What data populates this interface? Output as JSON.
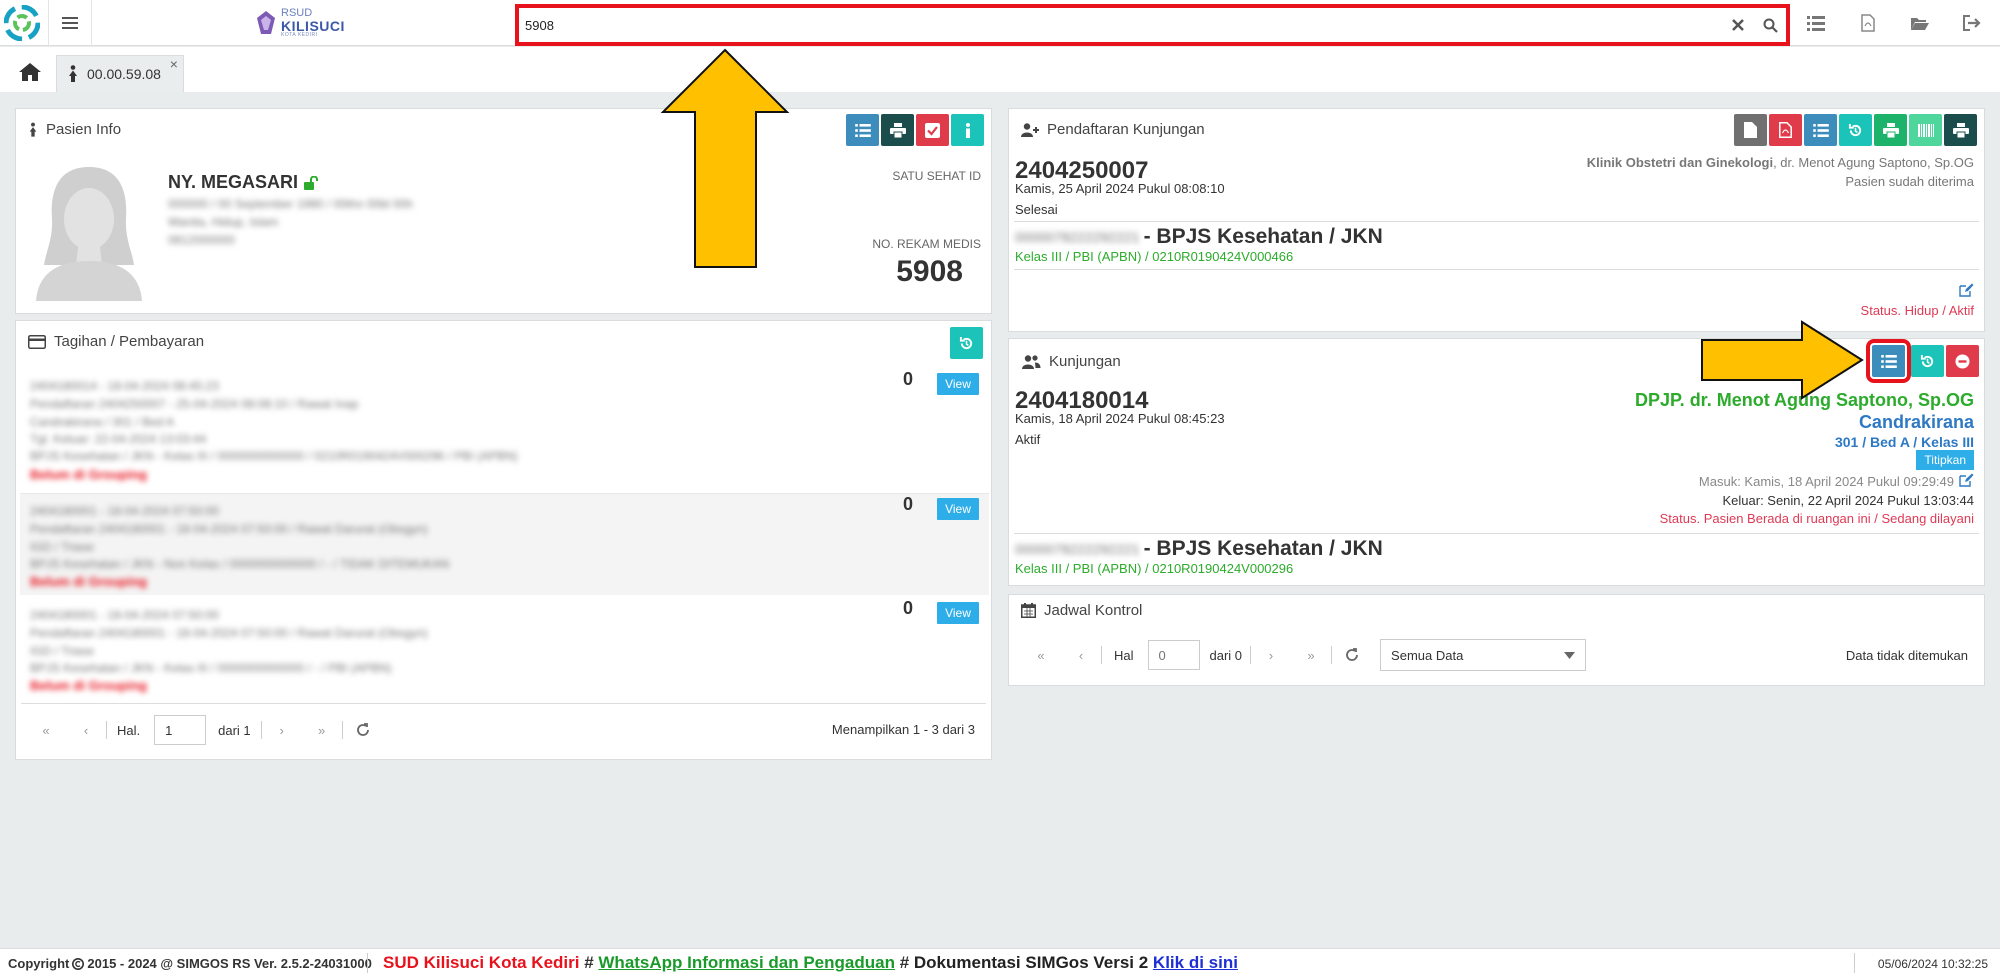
{
  "topbar": {
    "hospital_logo": {
      "line1": "RSUD",
      "line2": "KILISUCI",
      "line3": "KOTA KEDIRI"
    },
    "search": {
      "value": "5908"
    },
    "icons": [
      "list-icon",
      "pdf-file-icon",
      "folder-open-icon",
      "logout-icon"
    ]
  },
  "tabs": {
    "patient_tab_label": "00.00.59.08",
    "close_label": "×"
  },
  "pasien_info": {
    "title": "Pasien Info",
    "name": "NY. MEGASARI",
    "detail_line1": "000000 / 00 September 1980 / 00thn 00bl 00h",
    "detail_line2": "Wanita, Hidup, Islam",
    "detail_line3": "0812000000",
    "satu_sehat_label": "SATU SEHAT ID",
    "no_rm_label": "NO. REKAM MEDIS",
    "no_rm_value": "5908"
  },
  "tagihan": {
    "title": "Tagihan / Pembayaran",
    "items": [
      {
        "amount": "0",
        "view_label": "View",
        "lines": [
          "2404180014 - 18-04-2024 08:45:23",
          "Pendaftaran 2404250007 - 25-04-2024 08:08:10 / Rawat Inap",
          "Candrakirana / 301 / Bed A",
          "Tgl. Keluar: 22-04-2024 13:03:44",
          "BPJS Kesehatan / JKN - Kelas III / 0000000000000 / 0210R0190424V000296 / PBI (APBN)"
        ],
        "status": "Belum di Grouping"
      },
      {
        "amount": "0",
        "view_label": "View",
        "lines": [
          "2404180001 - 18-04-2024 07:50:00",
          "Pendaftaran 2404180001 - 18-04-2024 07:50:00 / Rawat Darurat (Obsgyn)",
          "IGD / Triase",
          "BPJS Kesehatan / JKN - Non Kelas / 0000000000000 / - / TIDAK DITEMUKAN"
        ],
        "status": "Belum di Grouping"
      },
      {
        "amount": "0",
        "view_label": "View",
        "lines": [
          "2404180001 - 18-04-2024 07:50:00",
          "Pendaftaran 2404180001 - 18-04-2024 07:50:00 / Rawat Darurat (Obsgyn)",
          "IGD / Triase",
          "BPJS Kesehatan / JKN - Kelas III / 0000000000000 / - / PBI (APBN)"
        ],
        "status": "Belum di Grouping"
      }
    ],
    "pager": {
      "hal_label": "Hal.",
      "page_value": "1",
      "of_label": "dari 1",
      "summary": "Menampilkan 1 - 3 dari 3"
    }
  },
  "pendaftaran": {
    "title": "Pendaftaran Kunjungan",
    "number": "2404250007",
    "date": "Kamis, 25 April 2024 Pukul 08:08:10",
    "status": "Selesai",
    "clinic": "Klinik Obstetri dan Ginekologi",
    "doctor": ", dr. Menot Agung Saptono, Sp.OG",
    "accepted": "Pasien sudah diterima",
    "bpjs_number": "0000078222292221",
    "insurer": "- BPJS Kesehatan / JKN",
    "kelas_line": "Kelas III / PBI (APBN) / 0210R0190424V000466",
    "life_status": "Status. Hidup / Aktif"
  },
  "kunjungan": {
    "title": "Kunjungan",
    "number": "2404180014",
    "date": "Kamis, 18 April 2024 Pukul 08:45:23",
    "status": "Aktif",
    "dpjp": "DPJP. dr. Menot Agung Saptono, Sp.OG",
    "room": "Candrakirana",
    "bed": "301 / Bed A / Kelas III",
    "titipkan_label": "Titipkan",
    "masuk": "Masuk: Kamis, 18 April 2024 Pukul 09:29:49",
    "keluar": "Keluar: Senin, 22 April 2024 Pukul 13:03:44",
    "room_status": "Status. Pasien Berada di ruangan ini / Sedang dilayani",
    "bpjs_number": "0000078222292221",
    "insurer": "- BPJS Kesehatan / JKN",
    "kelas_line": "Kelas III / PBI (APBN) / 0210R0190424V000296"
  },
  "jadwal": {
    "title": "Jadwal Kontrol",
    "hal_label": "Hal",
    "page_placeholder": "0",
    "of_label": "dari 0",
    "filter_value": "Semua Data",
    "empty": "Data tidak ditemukan"
  },
  "footer": {
    "copyright": "Copyright",
    "copyright_rest": " 2015 - 2024 @ SIMGOS RS Ver. 2.5.2-24031000",
    "marquee_red": "SUD Kilisuci Kota Kediri",
    "hash1": " # ",
    "whatsapp": "WhatsApp Informasi dan Pengaduan",
    "hash2": " # ",
    "dok": "Dokumentasi SIMGos Versi 2 ",
    "link": "Klik di sini",
    "datetime": "05/06/2024 10:32:25"
  },
  "colors": {
    "accent_red": "#e8121c",
    "arrow_yellow": "#ffc000",
    "btn_blue": "#3c8dbc",
    "btn_teal": "#1cc3b8",
    "green_text": "#2cab2c",
    "blue_text": "#2e79c4",
    "red_text": "#de3a55"
  }
}
